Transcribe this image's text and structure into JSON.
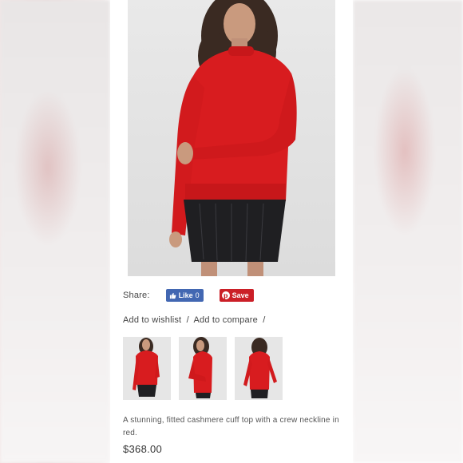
{
  "product": {
    "hero_image": "model-red-cashmere-top-front",
    "thumbnails": [
      {
        "alt": "model-red-top-front"
      },
      {
        "alt": "model-red-top-side"
      },
      {
        "alt": "model-red-top-back"
      }
    ],
    "description": "A stunning, fitted cashmere cuff top with a crew neckline in red.",
    "price": "$368.00"
  },
  "share": {
    "label": "Share:",
    "facebook_like_label": "Like",
    "facebook_like_count": "0",
    "pinterest_save_label": "Save"
  },
  "links": {
    "wishlist_label": "Add to wishlist",
    "compare_label": "Add to compare",
    "separator": "/"
  },
  "colors": {
    "facebook": "#4267b2",
    "pinterest": "#cb1f27",
    "sweater_red": "#d81c1f",
    "skirt_black": "#1f1f22"
  }
}
